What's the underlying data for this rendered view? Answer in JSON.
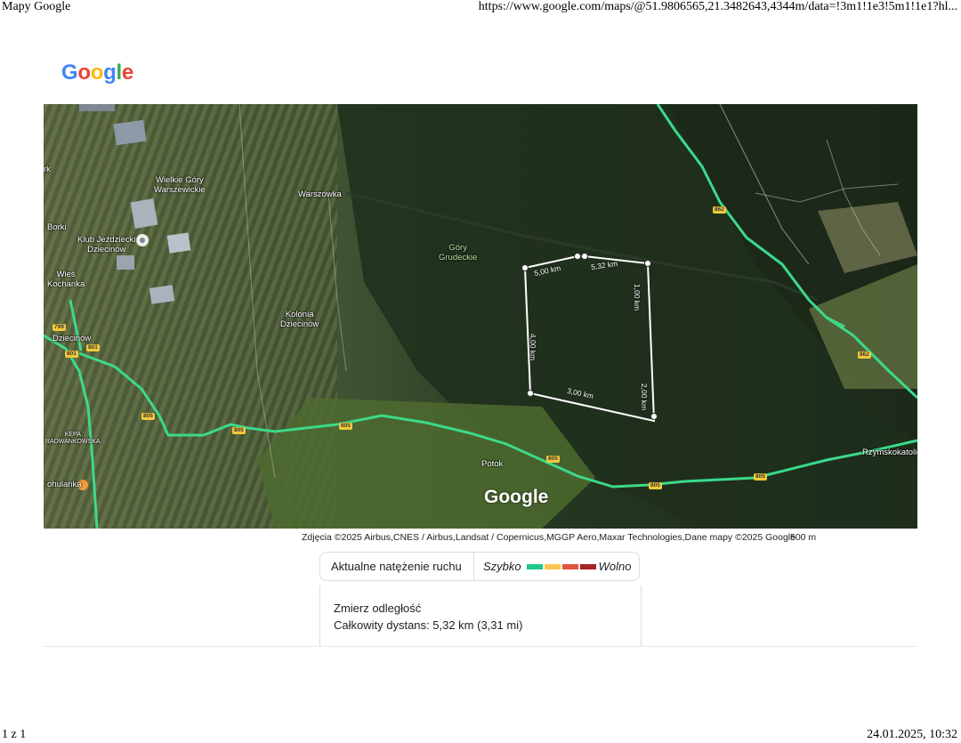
{
  "browser": {
    "title": "Mapy Google",
    "url": "https://www.google.com/maps/@51.9806565,21.3482643,4344m/data=!3m1!1e3!5m1!1e1?hl...",
    "page_counter": "1 z 1",
    "datetime": "24.01.2025, 10:32"
  },
  "logo": {
    "letters": [
      "G",
      "o",
      "o",
      "g",
      "l",
      "e"
    ],
    "colors": [
      "#4285F4",
      "#EA4335",
      "#FBBC05",
      "#4285F4",
      "#34A853",
      "#EA4335"
    ]
  },
  "map": {
    "watermark": "Google",
    "places": {
      "wielkie_gory": "Wielkie Góry\nWarszewickie",
      "borki": "Borki",
      "klub": "Klub Jeździecki\nDziecinów",
      "wies_kochanka": "Wieś\nKochanka",
      "warszowka": "Warszówka",
      "gory_grudeckie": "Góry\nGrudeckie",
      "kolonia": "Kolonia\nDziecinów",
      "dziecinow": "Dziecinów",
      "kepa": "KĘPA\nRADWANKOWSKA",
      "potok": "Potok",
      "rzymskokatol": "Rzymskokatolic",
      "sobiekursk": "ohulanka",
      "rk": "rk"
    },
    "distances": {
      "d1": "5,00 km",
      "d2": "5,32 km",
      "d3": "1,00 km",
      "d4": "4,00 km",
      "d5": "3,00 km",
      "d6": "2,00 km"
    },
    "road_shields": [
      "805",
      "801",
      "805",
      "805",
      "805",
      "805",
      "862",
      "862",
      "801",
      "799",
      "805"
    ],
    "traffic_color": "#3cd98b"
  },
  "attribution": "Zdjęcia ©2025 Airbus,CNES / Airbus,Landsat / Copernicus,MGGP Aero,Maxar Technologies,Dane mapy ©2025 Google",
  "scale_label": "500 m",
  "traffic": {
    "title": "Aktualne natężenie ruchu",
    "fast": "Szybko",
    "slow": "Wolno",
    "colors": [
      "#1ec98a",
      "#f9c74f",
      "#e0543e",
      "#a82226"
    ]
  },
  "measure": {
    "title": "Zmierz odległość",
    "total": "Całkowity dystans: 5,32 km (3,31 mi)"
  }
}
